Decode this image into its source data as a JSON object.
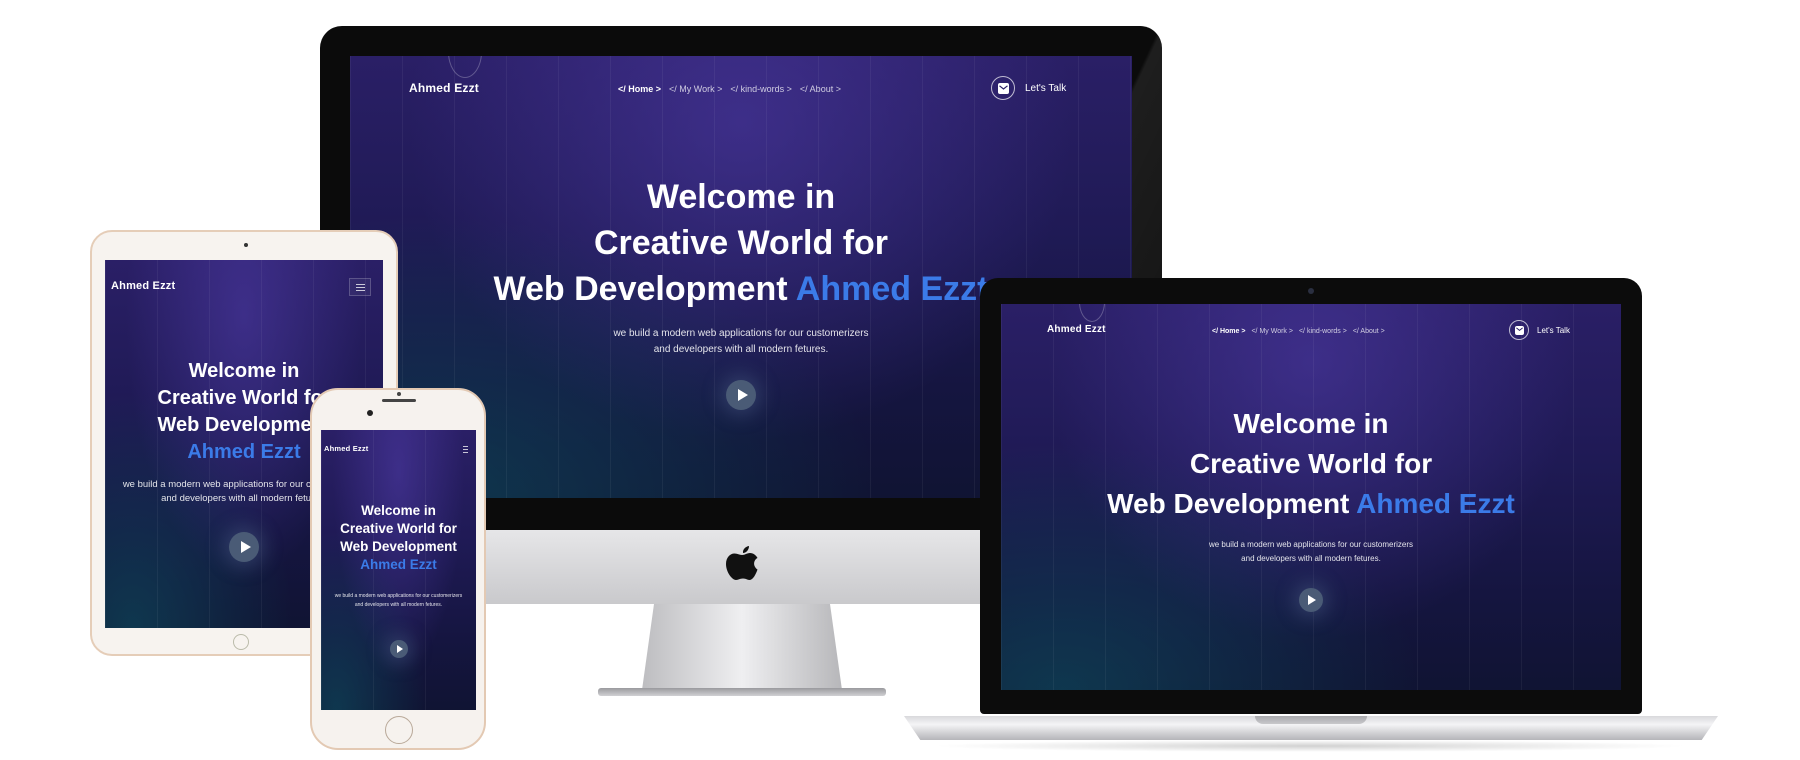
{
  "site": {
    "brand": "Ahmed Ezzt",
    "nav": [
      "</ Home >",
      "</ My Work >",
      "</ kind-words >",
      "</ About >"
    ],
    "cta": "Let's Talk",
    "hero": {
      "line1": "Welcome in",
      "line2": "Creative World for",
      "line3": "Web Development",
      "accent": "Ahmed Ezzt"
    },
    "subtitle": {
      "line1": "we build a modern web applications for our customerizers",
      "line2": "and developers with all modern fetures."
    }
  },
  "colors": {
    "accent": "#3b7be8",
    "background_top": "#2a1f66",
    "background_bottom": "#101433",
    "play_button": "#4a5b76"
  },
  "icons": [
    "apple-logo-icon",
    "mail-icon",
    "play-icon",
    "hamburger-menu-icon"
  ]
}
